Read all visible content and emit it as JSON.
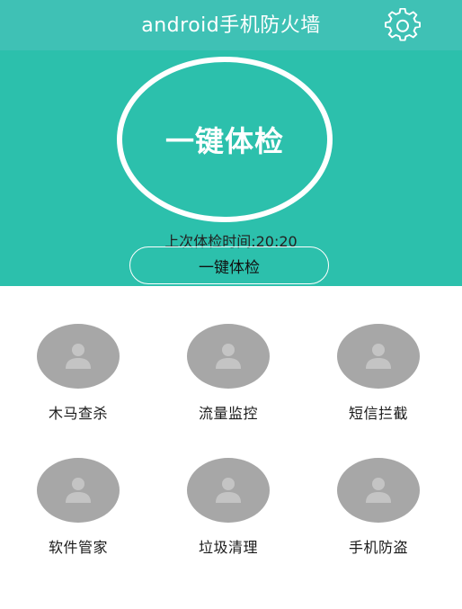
{
  "header": {
    "title": "android手机防火墙",
    "settings_icon": "gear-icon"
  },
  "hero": {
    "circle_label": "一键体检",
    "last_check_text": "上次体检时间:20:20",
    "button_label": "一键体检"
  },
  "colors": {
    "header_bg": "#3fc1b5",
    "hero_bg": "#2cc0ac",
    "placeholder_gray": "#a7a7a7"
  },
  "features": [
    {
      "label": "木马查杀",
      "icon": "user-placeholder-icon"
    },
    {
      "label": "流量监控",
      "icon": "user-placeholder-icon"
    },
    {
      "label": "短信拦截",
      "icon": "user-placeholder-icon"
    },
    {
      "label": "软件管家",
      "icon": "user-placeholder-icon"
    },
    {
      "label": "垃圾清理",
      "icon": "user-placeholder-icon"
    },
    {
      "label": "手机防盗",
      "icon": "user-placeholder-icon"
    }
  ]
}
